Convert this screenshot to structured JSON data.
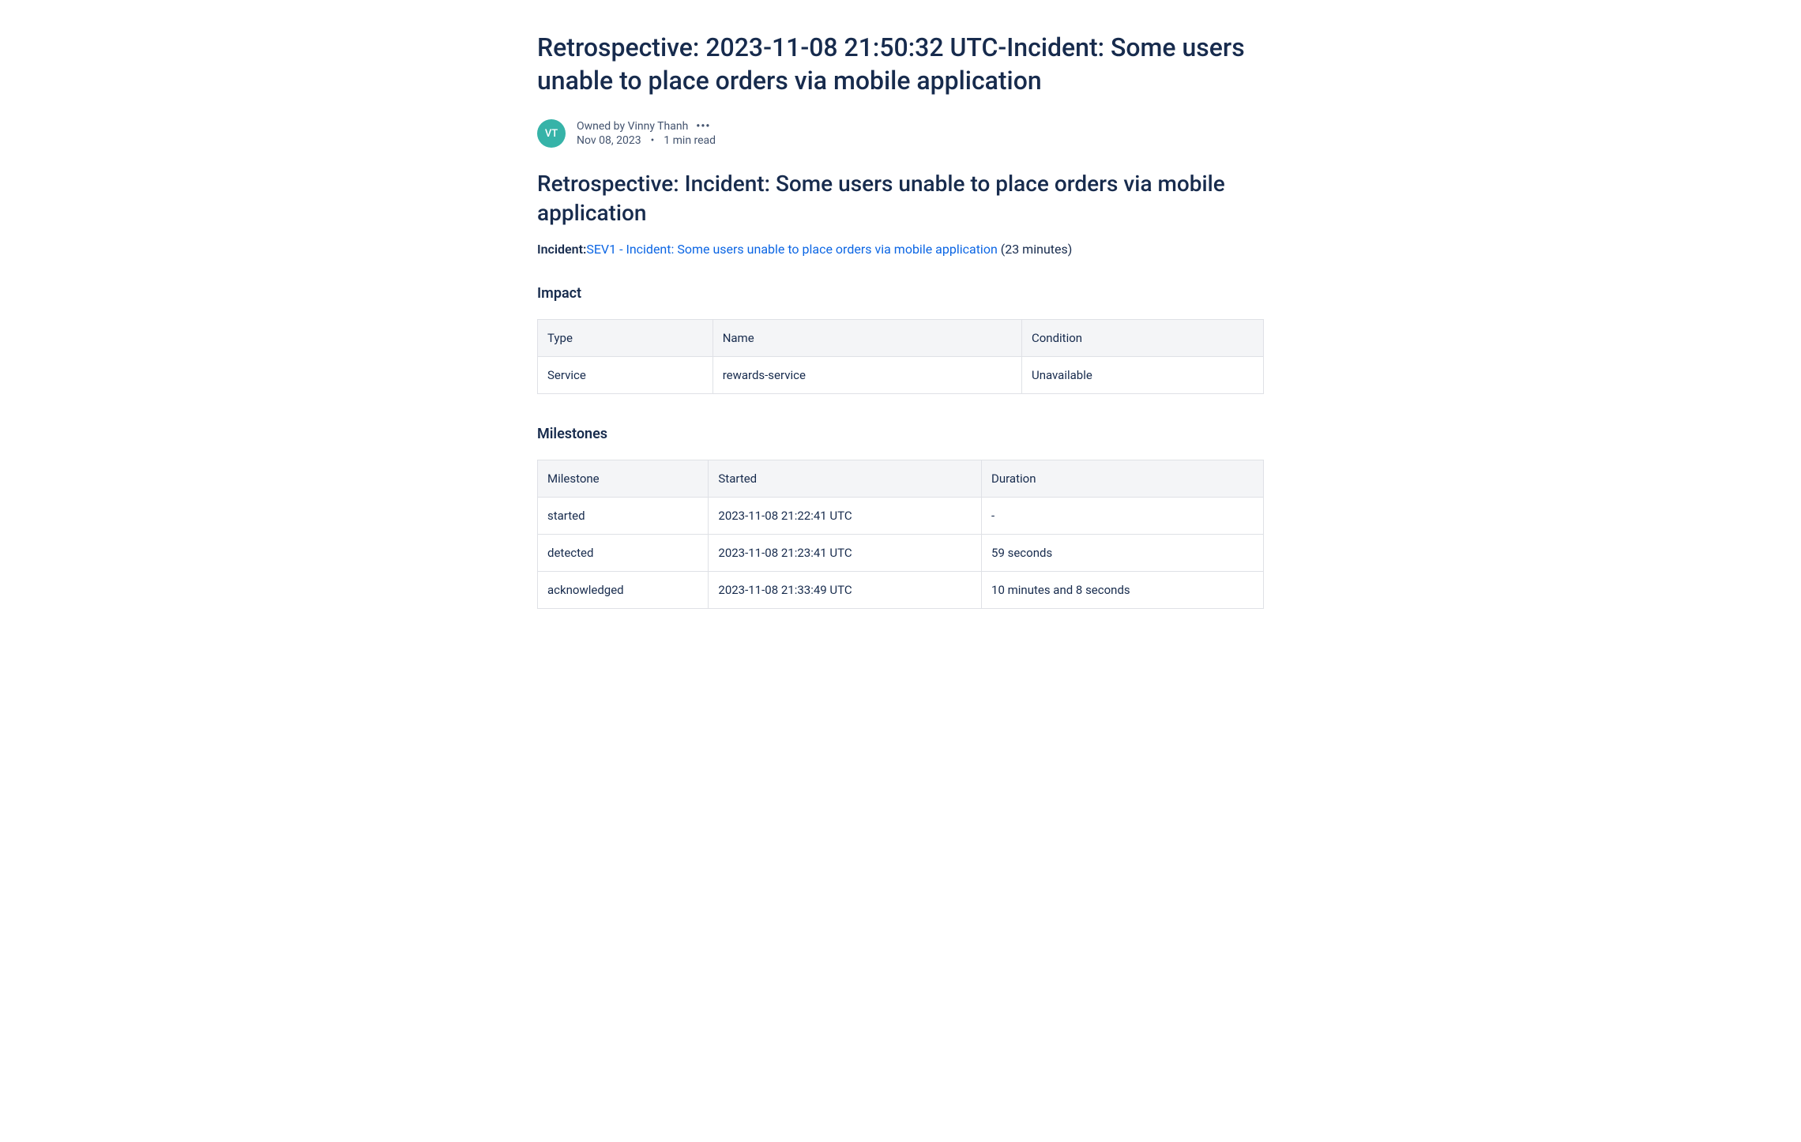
{
  "page_title": "Retrospective: 2023-11-08 21:50:32 UTC-Incident: Some users unable to place orders via mobile application",
  "byline": {
    "avatar_initials": "VT",
    "owned_by_prefix": "Owned by ",
    "owner": "Vinny Thanh",
    "date": "Nov 08, 2023",
    "read_time": "1 min read"
  },
  "section_heading": "Retrospective: Incident: Some users unable to place orders via mobile application",
  "incident": {
    "label": "Incident:",
    "link_text": "SEV1 - Incident: Some users unable to place orders via mobile application",
    "duration_suffix": " (23 minutes)"
  },
  "impact": {
    "heading": "Impact",
    "headers": [
      "Type",
      "Name",
      "Condition"
    ],
    "rows": [
      [
        "Service",
        "rewards-service",
        "Unavailable"
      ]
    ]
  },
  "milestones": {
    "heading": "Milestones",
    "headers": [
      "Milestone",
      "Started",
      "Duration"
    ],
    "rows": [
      [
        "started",
        "2023-11-08 21:22:41 UTC",
        "-"
      ],
      [
        "detected",
        "2023-11-08 21:23:41 UTC",
        "59 seconds"
      ],
      [
        "acknowledged",
        "2023-11-08 21:33:49 UTC",
        "10 minutes and 8 seconds"
      ]
    ]
  }
}
